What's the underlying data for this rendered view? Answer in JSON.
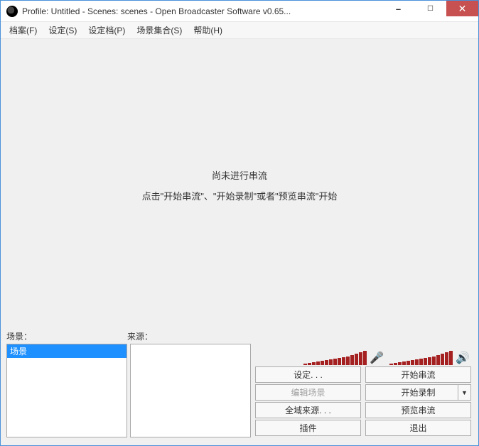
{
  "window": {
    "title": "Profile: Untitled - Scenes: scenes - Open Broadcaster Software v0.65..."
  },
  "menus": {
    "file": "档案(F)",
    "settings": "设定(S)",
    "profiles": "设定档(P)",
    "scene_collections": "场景集合(S)",
    "help": "帮助(H)"
  },
  "preview": {
    "line1": "尚未进行串流",
    "line2": "点击\"开始串流\"、\"开始录制\"或者\"预览串流\"开始"
  },
  "labels": {
    "scenes": "场景：",
    "sources": "来源："
  },
  "scenes": {
    "items": [
      {
        "label": "场景"
      }
    ]
  },
  "buttons": {
    "settings": "设定. . .",
    "start_streaming": "开始串流",
    "edit_scene": "编辑场景",
    "start_recording": "开始录制",
    "global_sources": "全域来源. . .",
    "preview_stream": "预览串流",
    "plugins": "插件",
    "exit": "退出"
  },
  "icons": {
    "mic": "🎤",
    "speaker": "🔊"
  }
}
